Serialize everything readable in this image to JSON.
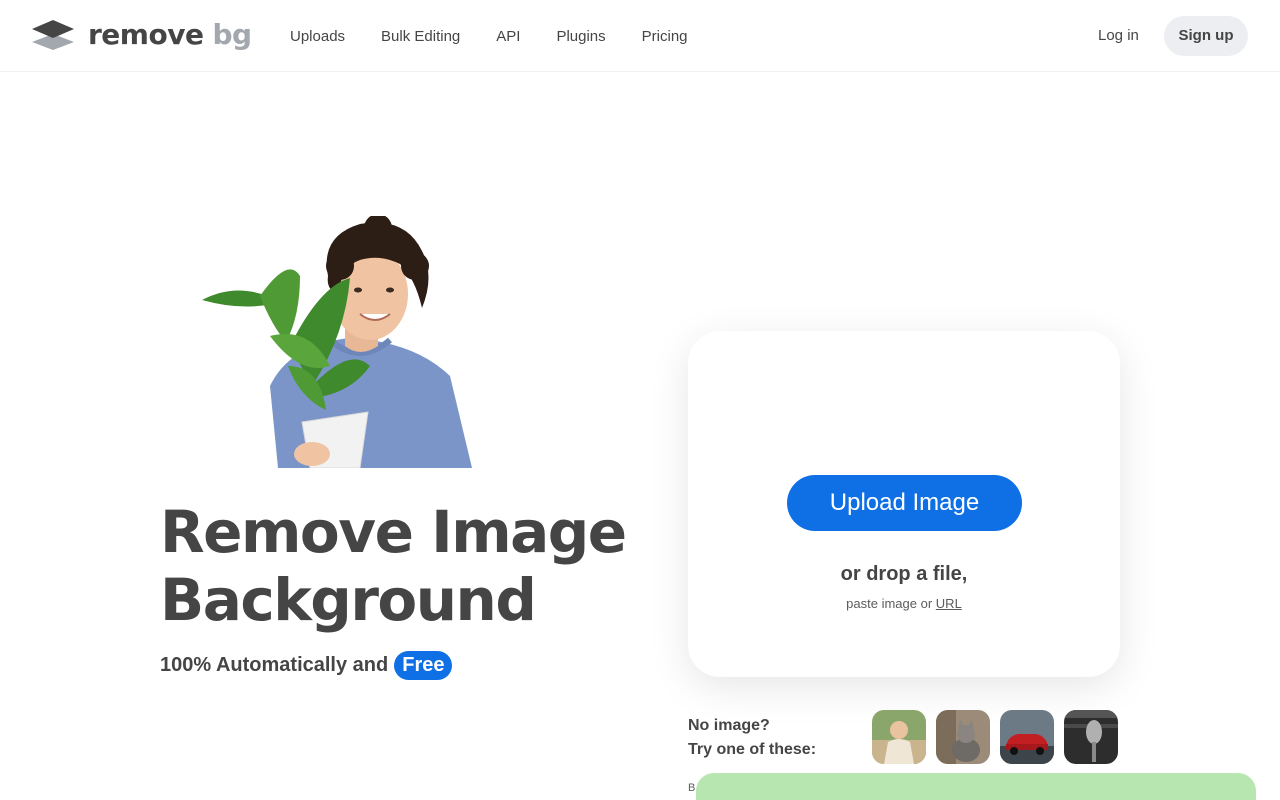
{
  "header": {
    "logo": {
      "word1": "remove",
      "word2": "bg"
    },
    "nav": [
      "Uploads",
      "Bulk Editing",
      "API",
      "Plugins",
      "Pricing"
    ],
    "login_label": "Log in",
    "signup_label": "Sign up"
  },
  "hero": {
    "title_line1": "Remove Image",
    "title_line2": "Background",
    "subtitle": "100% Automatically and",
    "free_badge": "Free"
  },
  "upload": {
    "button_label": "Upload Image",
    "drop_text": "or drop a file,",
    "paste_prefix": "paste image or",
    "url_link": "URL"
  },
  "samples": {
    "line1": "No image?",
    "line2": "Try one of these:",
    "thumbs": [
      "woman-sample",
      "cat-sample",
      "car-sample",
      "microphone-sample"
    ]
  },
  "bottom": {
    "partial_text": "B"
  },
  "colors": {
    "accent": "#0f70e6",
    "text": "#454545",
    "logo_gray": "#a3a7ae",
    "signup_bg": "#eceef1",
    "banner_green": "#b8e6b0"
  }
}
